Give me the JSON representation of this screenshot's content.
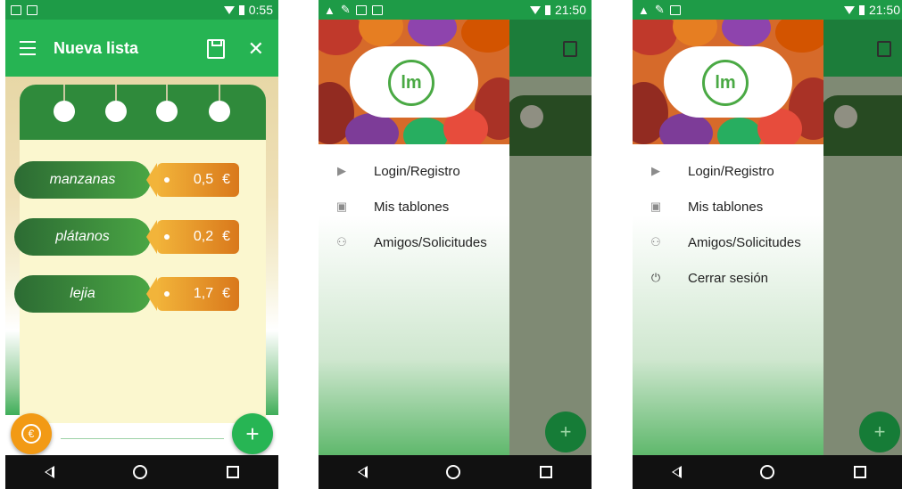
{
  "screen1": {
    "status": {
      "time": "0:55"
    },
    "appbar": {
      "title": "Nueva lista"
    },
    "items": [
      {
        "name": "manzanas",
        "price": "0,5",
        "currency": "€"
      },
      {
        "name": "plátanos",
        "price": "0,2",
        "currency": "€"
      },
      {
        "name": "lejia",
        "price": "1,7",
        "currency": "€"
      }
    ],
    "fab_euro": "€",
    "fab_add": "+"
  },
  "screen2": {
    "status": {
      "time": "21:50"
    },
    "logo_text": "lm",
    "menu": [
      {
        "label": "Login/Registro",
        "icon": "send-icon"
      },
      {
        "label": "Mis tablones",
        "icon": "board-icon"
      },
      {
        "label": "Amigos/Solicitudes",
        "icon": "friends-icon"
      }
    ]
  },
  "screen3": {
    "status": {
      "time": "21:50"
    },
    "logo_text": "lm",
    "menu": [
      {
        "label": "Login/Registro",
        "icon": "send-icon"
      },
      {
        "label": "Mis tablones",
        "icon": "board-icon"
      },
      {
        "label": "Amigos/Solicitudes",
        "icon": "friends-icon"
      },
      {
        "label": "Cerrar sesión",
        "icon": "power-icon"
      }
    ]
  },
  "colors": {
    "primary": "#26b453",
    "card_top": "#2f8a3b",
    "tag": "#e08a22",
    "fab_euro": "#f29a15"
  }
}
